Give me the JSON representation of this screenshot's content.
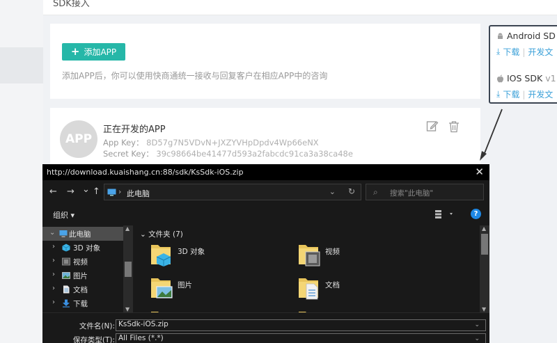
{
  "page": {
    "header_title": "SDK接入"
  },
  "add_card": {
    "button_label": "添加APP",
    "hint": "添加APP后，你可以使用快商通统一接收与回复客户在相应APP中的咨询"
  },
  "app_card": {
    "avatar_text": "APP",
    "name": "正在开发的APP",
    "app_key_label": "App Key：",
    "app_key_value": "8D57g7N5VDvN+JXZYVHpDpdv4Wp66eNX",
    "secret_key_label": "Secret Key：",
    "secret_key_value": "39c98664be41477d593a2fabcdc91ca3a38ca48e"
  },
  "sdk_panel": {
    "android_title": "Android SD",
    "ios_title": "IOS SDK",
    "ios_version": "v1",
    "download_label": "下载",
    "docs_label": "开发文"
  },
  "dialog": {
    "title_url": "http://download.kuaishang.cn:88/sdk/KsSdk-iOS.zip",
    "close_glyph": "✕",
    "nav": {
      "back": "←",
      "forward": "→",
      "recent": "⌄",
      "up": "↑",
      "location": "此电脑",
      "refresh": "↻",
      "search_placeholder": "搜索\"此电脑\""
    },
    "organize_label": "组织 ▾",
    "help_label": "?",
    "tree": [
      {
        "label": "此电脑",
        "chev": "⌄"
      },
      {
        "label": "3D 对象",
        "chev": "›"
      },
      {
        "label": "视频",
        "chev": "›"
      },
      {
        "label": "图片",
        "chev": "›"
      },
      {
        "label": "文档",
        "chev": "›"
      },
      {
        "label": "下载",
        "chev": "›"
      }
    ],
    "folders_header": "⌄ 文件夹 (7)",
    "folders": [
      {
        "label": "3D 对象"
      },
      {
        "label": "视频"
      },
      {
        "label": "图片"
      },
      {
        "label": "文档"
      }
    ],
    "filename_label": "文件名(N):",
    "filename_value": "KsSdk-iOS.zip",
    "filetype_label": "保存类型(T):",
    "filetype_value": "All Files (*.*)"
  },
  "colors": {
    "accent": "#26b7a8",
    "link": "#3aa0d8",
    "dialog_bg": "#191919",
    "selection": "#4d4d4d"
  }
}
